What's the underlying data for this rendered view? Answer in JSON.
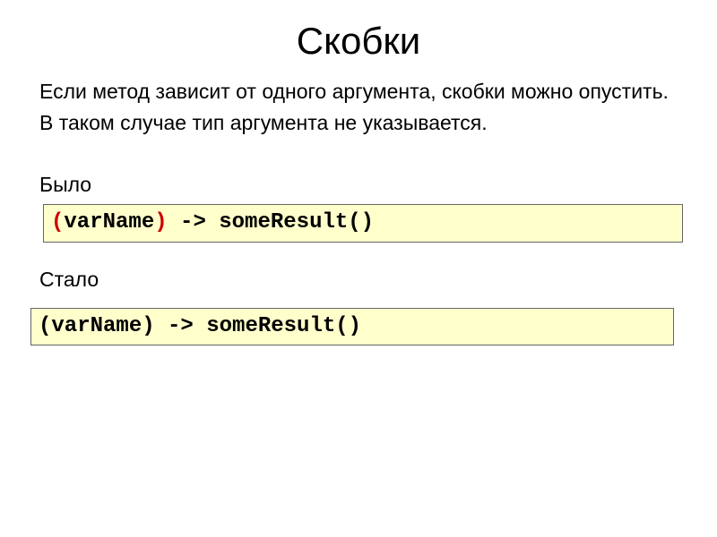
{
  "title": "Скобки",
  "body": {
    "line1": "Если метод зависит от одного аргумента, скобки можно опустить.",
    "line2": "В таком случае тип аргумента не указывается."
  },
  "before": {
    "label": "Было",
    "code": {
      "open": "(",
      "var": "varName",
      "close": ")",
      "rest": " -> someResult()"
    }
  },
  "after": {
    "label": "Стало",
    "code_full": "(varName) -> someResult()"
  }
}
